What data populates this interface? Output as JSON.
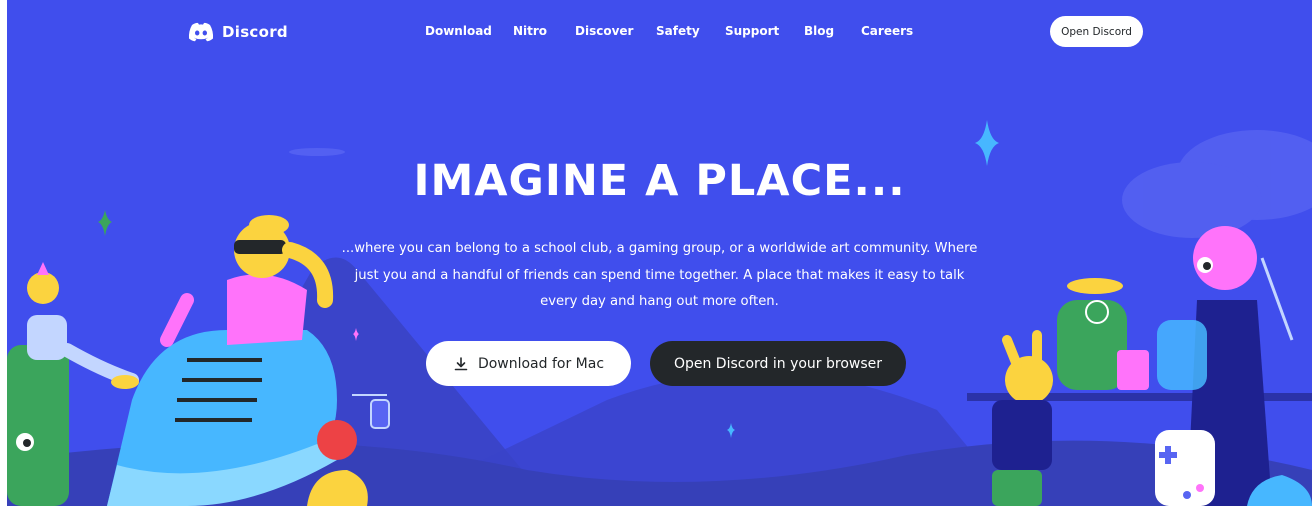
{
  "brand": {
    "name": "Discord",
    "icon": "discord-logo-icon"
  },
  "nav": {
    "links": [
      "Download",
      "Nitro",
      "Discover",
      "Safety",
      "Support",
      "Blog",
      "Careers"
    ],
    "open_button": "Open Discord"
  },
  "hero": {
    "headline": "IMAGINE A PLACE...",
    "subtext": "...where you can belong to a school club, a gaming group, or a worldwide art community. Where just you and a handful of friends can spend time together. A place that makes it easy to talk every day and hang out more often.",
    "download_button": "Download for Mac",
    "download_icon": "download-icon",
    "browser_button": "Open Discord in your browser"
  },
  "colors": {
    "blurple": "#404eed",
    "dark": "#23272a",
    "white": "#ffffff",
    "pink": "#ff73fa",
    "green": "#3ba55c",
    "yellow": "#fbd33f",
    "cyan": "#47b7ff"
  }
}
